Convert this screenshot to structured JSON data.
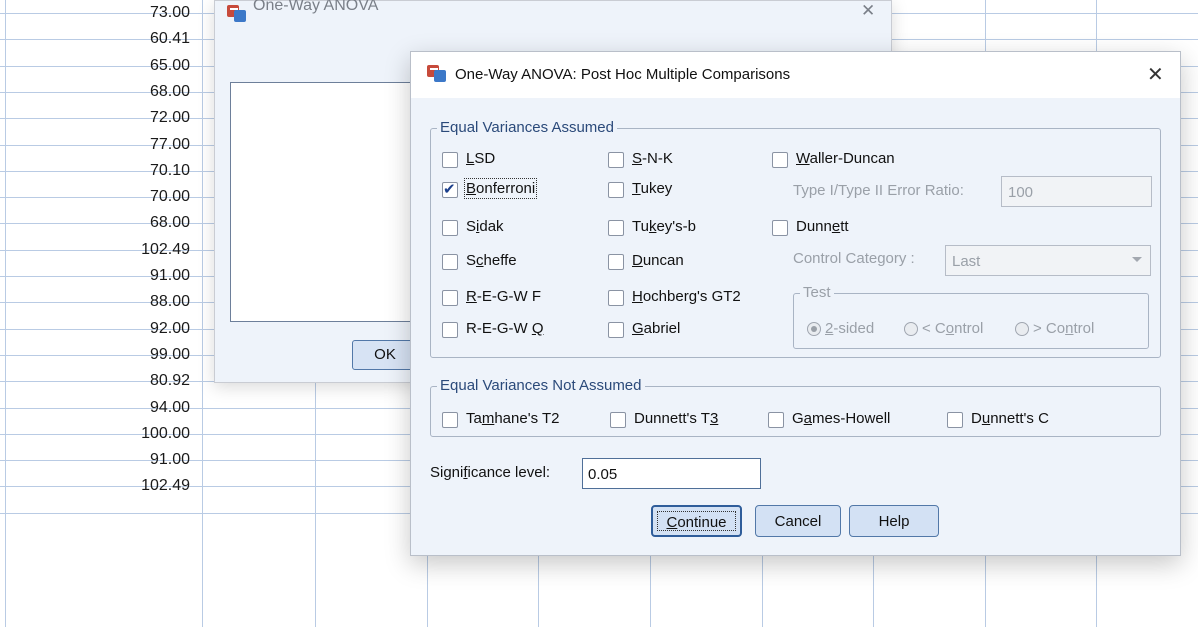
{
  "spreadsheet": {
    "values": [
      "73.00",
      "60.41",
      "65.00",
      "68.00",
      "72.00",
      "77.00",
      "70.10",
      "70.00",
      "68.00",
      "102.49",
      "91.00",
      "88.00",
      "92.00",
      "99.00",
      "80.92",
      "94.00",
      "100.00",
      "91.00",
      "102.49"
    ]
  },
  "background_dialog": {
    "title": "One-Way ANOVA",
    "close_label": "✕",
    "ok_label": "OK"
  },
  "dialog": {
    "title": "One-Way ANOVA: Post Hoc Multiple Comparisons",
    "close_label": "✕",
    "equal_assumed": {
      "legend": "Equal Variances Assumed",
      "options": [
        {
          "prefix": "",
          "ul": "L",
          "suffix": "SD",
          "checked": false
        },
        {
          "prefix": "",
          "ul": "B",
          "suffix": "onferroni",
          "checked": true
        },
        {
          "prefix": "S",
          "ul": "i",
          "suffix": "dak",
          "checked": false
        },
        {
          "prefix": "S",
          "ul": "c",
          "suffix": "heffe",
          "checked": false
        },
        {
          "prefix": "",
          "ul": "R",
          "suffix": "-E-G-W F",
          "checked": false
        },
        {
          "prefix": "R-E-G-W ",
          "ul": "Q",
          "suffix": "",
          "checked": false
        },
        {
          "prefix": "",
          "ul": "S",
          "suffix": "-N-K",
          "checked": false
        },
        {
          "prefix": "",
          "ul": "T",
          "suffix": "ukey",
          "checked": false
        },
        {
          "prefix": "Tu",
          "ul": "k",
          "suffix": "ey's-b",
          "checked": false
        },
        {
          "prefix": "",
          "ul": "D",
          "suffix": "uncan",
          "checked": false
        },
        {
          "prefix": "",
          "ul": "H",
          "suffix": "ochberg's GT2",
          "checked": false
        },
        {
          "prefix": "",
          "ul": "G",
          "suffix": "abriel",
          "checked": false
        },
        {
          "prefix": "",
          "ul": "W",
          "suffix": "aller-Duncan",
          "checked": false
        },
        {
          "prefix": "Dunn",
          "ul": "e",
          "suffix": "tt",
          "checked": false
        }
      ],
      "ratio_label": "Type I/Type II Error Ratio:",
      "ratio_value": "100",
      "control_label": "Control Category :",
      "control_value": "Last",
      "test": {
        "legend": "Test",
        "options": [
          {
            "prefix": "",
            "ul": "2",
            "suffix": "-sided",
            "selected": true
          },
          {
            "prefix": "< C",
            "ul": "o",
            "suffix": "ntrol",
            "selected": false
          },
          {
            "prefix": "> Co",
            "ul": "n",
            "suffix": "trol",
            "selected": false
          }
        ]
      }
    },
    "equal_not_assumed": {
      "legend": "Equal Variances Not Assumed",
      "options": [
        {
          "prefix": "Ta",
          "ul": "m",
          "suffix": "hane's T2",
          "checked": false
        },
        {
          "prefix": "Dunnett's T",
          "ul": "3",
          "suffix": "",
          "checked": false
        },
        {
          "prefix": "G",
          "ul": "a",
          "suffix": "mes-Howell",
          "checked": false
        },
        {
          "prefix": "D",
          "ul": "u",
          "suffix": "nnett's C",
          "checked": false
        }
      ]
    },
    "significance": {
      "prefix": "Signi",
      "ul": "f",
      "suffix": "icance level:",
      "value": "0.05"
    },
    "buttons": {
      "continue": {
        "prefix": "",
        "ul": "C",
        "suffix": "ontinue"
      },
      "cancel": "Cancel",
      "help": "Help"
    }
  }
}
